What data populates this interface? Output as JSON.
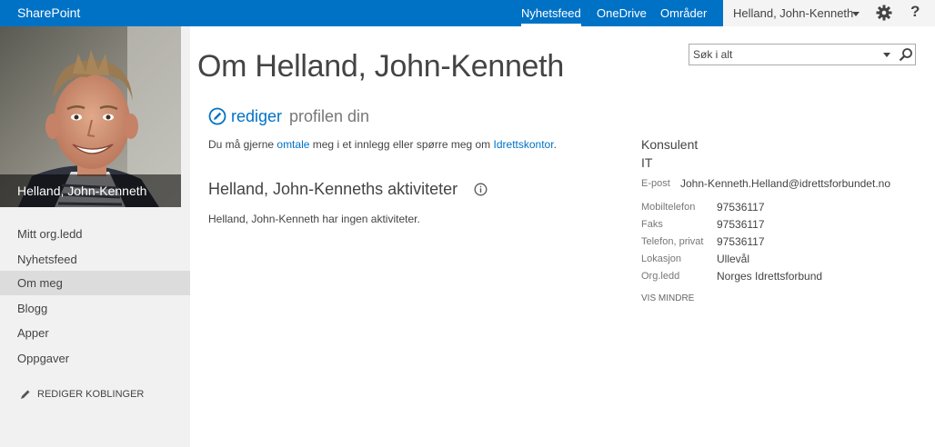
{
  "suite_bar": {
    "brand": "SharePoint",
    "nav": [
      "Nyhetsfeed",
      "OneDrive",
      "Områder"
    ],
    "active_nav": "Nyhetsfeed",
    "user_name": "Helland, John-Kenneth",
    "settings_icon": "gear-icon",
    "help_label": "?",
    "colors": {
      "bar": "#0072c6",
      "user_box": "#f4f4f4"
    }
  },
  "profile_photo": {
    "caption": "Helland, John-Kenneth"
  },
  "left_nav": {
    "items": [
      "Mitt org.ledd",
      "Nyhetsfeed",
      "Om meg",
      "Blogg",
      "Apper",
      "Oppgaver"
    ],
    "selected": "Om meg",
    "edit_links_label": "REDIGER KOBLINGER"
  },
  "search": {
    "placeholder": "Søk i alt"
  },
  "main": {
    "title": "Om Helland, John-Kenneth",
    "edit_link": "rediger",
    "edit_rest": "profilen din",
    "mention_prefix": "Du må gjerne",
    "mention_link": "omtale",
    "mention_middle": "meg i et innlegg eller spørre meg om",
    "mention_topic": "Idrettskontor",
    "mention_suffix": ".",
    "activities_heading": "Helland, John-Kenneths aktiviteter",
    "no_activities": "Helland, John-Kenneth har ingen aktiviteter."
  },
  "contact": {
    "job_title": "Konsulent",
    "department": "IT",
    "email_label": "E-post",
    "email": "John-Kenneth.Helland@idrettsforbundet.no",
    "details": [
      {
        "label": "Mobiltelefon",
        "value": "97536117"
      },
      {
        "label": "Faks",
        "value": "97536117"
      },
      {
        "label": "Telefon, privat",
        "value": "97536117"
      },
      {
        "label": "Lokasjon",
        "value": "Ullevål"
      },
      {
        "label": "Org.ledd",
        "value": "Norges Idrettsforbund"
      }
    ],
    "show_less": "VIS MINDRE"
  },
  "colors": {
    "link": "#0072c6",
    "text": "#444444",
    "left_panel": "#f1f1f1",
    "selected_nav": "#dcdcdc"
  }
}
